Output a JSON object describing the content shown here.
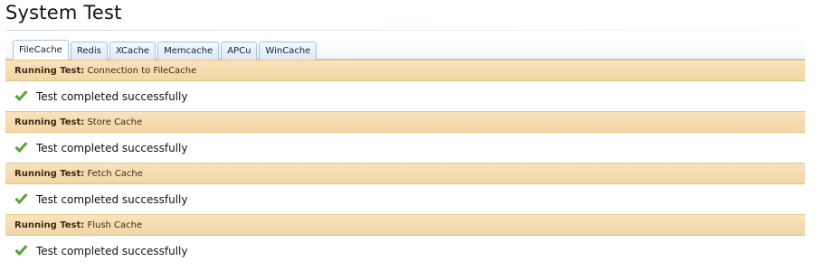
{
  "page": {
    "title": "System Test"
  },
  "tabs": [
    {
      "label": "FileCache",
      "active": true
    },
    {
      "label": "Redis",
      "active": false
    },
    {
      "label": "XCache",
      "active": false
    },
    {
      "label": "Memcache",
      "active": false
    },
    {
      "label": "APCu",
      "active": false
    },
    {
      "label": "WinCache",
      "active": false
    }
  ],
  "tests": [
    {
      "prefix": "Running Test:",
      "name": "Connection to FileCache",
      "result": "Test completed successfully"
    },
    {
      "prefix": "Running Test:",
      "name": "Store Cache",
      "result": "Test completed successfully"
    },
    {
      "prefix": "Running Test:",
      "name": "Fetch Cache",
      "result": "Test completed successfully"
    },
    {
      "prefix": "Running Test:",
      "name": "Flush Cache",
      "result": "Test completed successfully"
    }
  ],
  "icons": {
    "result": "checkmark-icon"
  },
  "colors": {
    "header_bg": "#f5dcaf",
    "tab_border": "#a9c1da",
    "check_green": "#5cb130"
  }
}
